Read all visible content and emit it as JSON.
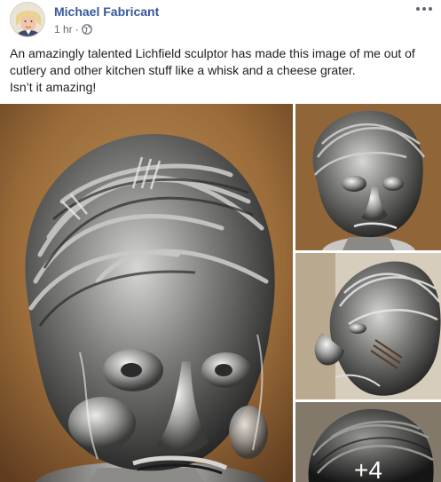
{
  "post": {
    "author": "Michael Fabricant",
    "time": "1 hr",
    "separator": "·",
    "text_lines": [
      "An amazingly talented Lichfield sculptor has made this image of me out of cutlery and other kitchen stuff like a whisk and a cheese grater.",
      "Isn’t it amazing!"
    ]
  },
  "gallery": {
    "more_count": "+4"
  },
  "icons": {
    "avatar": "profile-photo",
    "privacy": "globe-icon",
    "menu": "more-options-icon"
  },
  "colors": {
    "author_link": "#385898",
    "meta_text": "#606770",
    "body_text": "#1c1e21"
  }
}
